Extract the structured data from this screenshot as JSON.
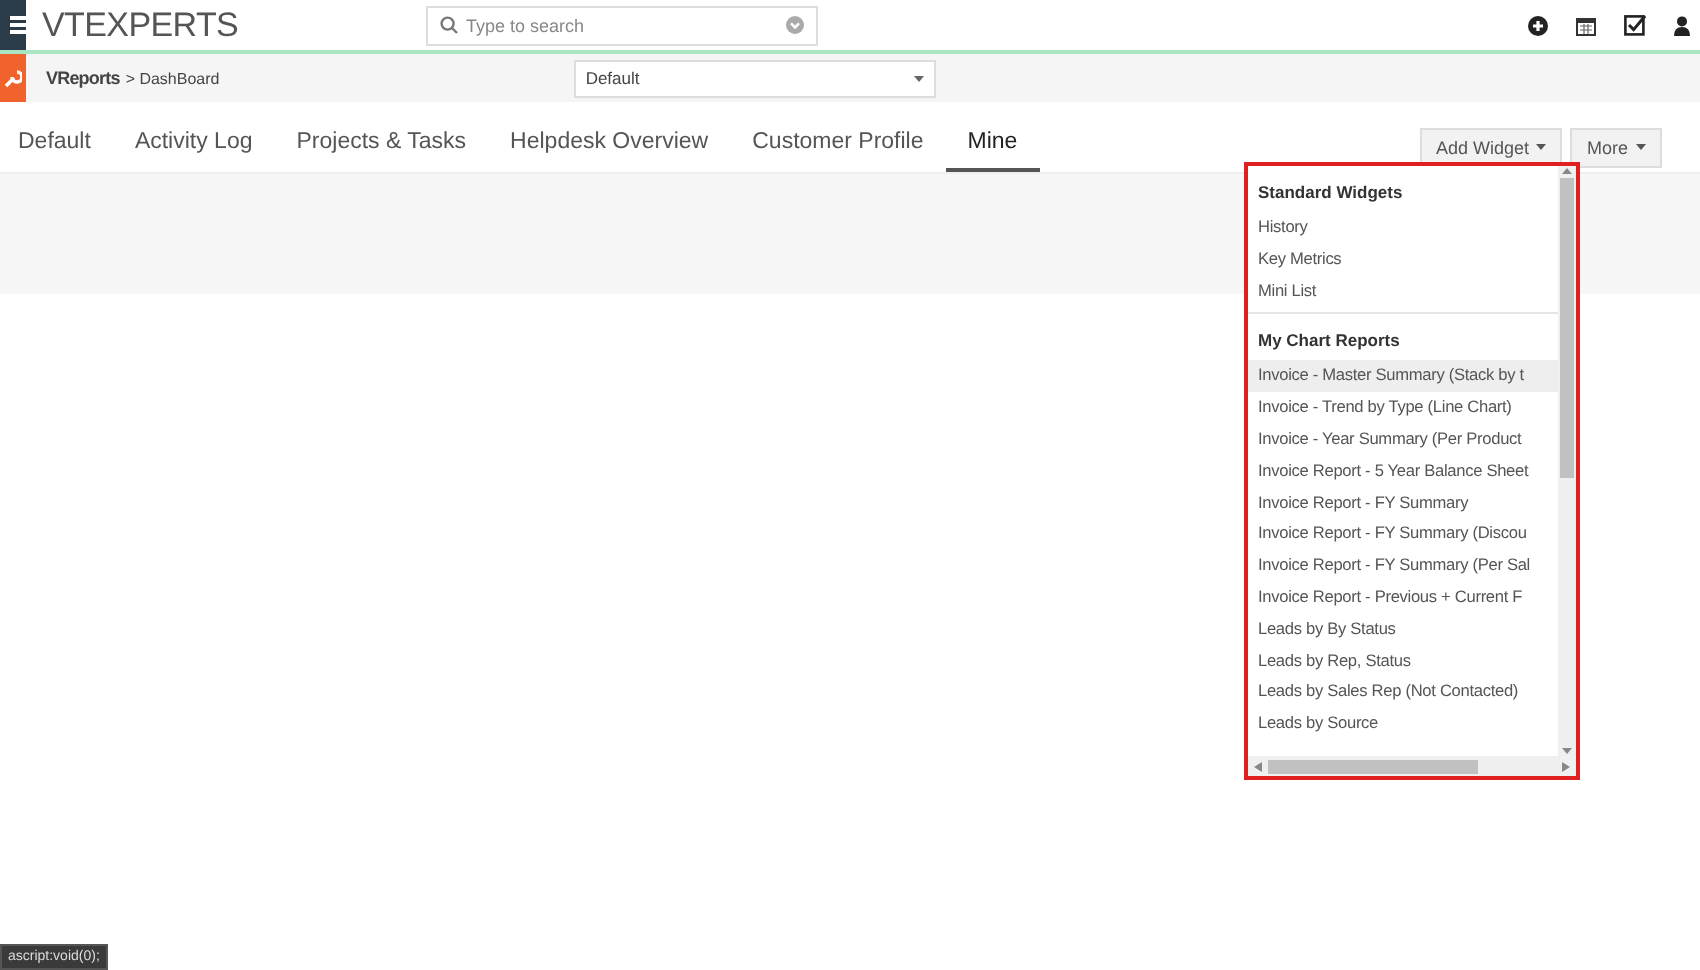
{
  "header": {
    "logo": "VTEXPERTS",
    "search": {
      "placeholder": "Type to search"
    }
  },
  "subbar": {
    "module": "VReports",
    "breadcrumb": "> DashBoard",
    "dashboard_select": "Default"
  },
  "tabs": [
    {
      "label": "Default",
      "selected": false
    },
    {
      "label": "Activity Log",
      "selected": false
    },
    {
      "label": "Projects & Tasks",
      "selected": false
    },
    {
      "label": "Helpdesk Overview",
      "selected": false
    },
    {
      "label": "Customer Profile",
      "selected": false
    },
    {
      "label": "Mine",
      "selected": true
    }
  ],
  "buttons": [
    "Add Widget",
    "More"
  ],
  "widget_menu": {
    "sections": [
      {
        "title": "Standard Widgets",
        "items": [
          {
            "label": "History",
            "selected": false
          },
          {
            "label": "Key Metrics",
            "selected": false
          },
          {
            "label": "Mini List",
            "selected": false
          }
        ]
      },
      {
        "title": "My Chart Reports",
        "items": [
          {
            "label": "Invoice - Master Summary (Stack by t",
            "selected": true
          },
          {
            "label": "Invoice - Trend by Type (Line Chart)",
            "selected": false
          },
          {
            "label": "Invoice - Year Summary (Per Product",
            "selected": false
          },
          {
            "label": "Invoice Report - 5 Year Balance Sheet",
            "selected": false
          },
          {
            "label": "Invoice Report - FY Summary",
            "selected": false
          },
          {
            "label": "Invoice Report - FY Summary (Discou",
            "selected": false
          },
          {
            "label": "Invoice Report - FY Summary (Per Sal",
            "selected": false
          },
          {
            "label": "Invoice Report - Previous + Current F",
            "selected": false
          },
          {
            "label": "Leads by By Status",
            "selected": false
          },
          {
            "label": "Leads by Rep, Status",
            "selected": false
          },
          {
            "label": "Leads by Sales Rep (Not Contacted)",
            "selected": false
          },
          {
            "label": "Leads by Source",
            "selected": false
          }
        ]
      }
    ]
  },
  "status_tip": "ascript:void(0);"
}
